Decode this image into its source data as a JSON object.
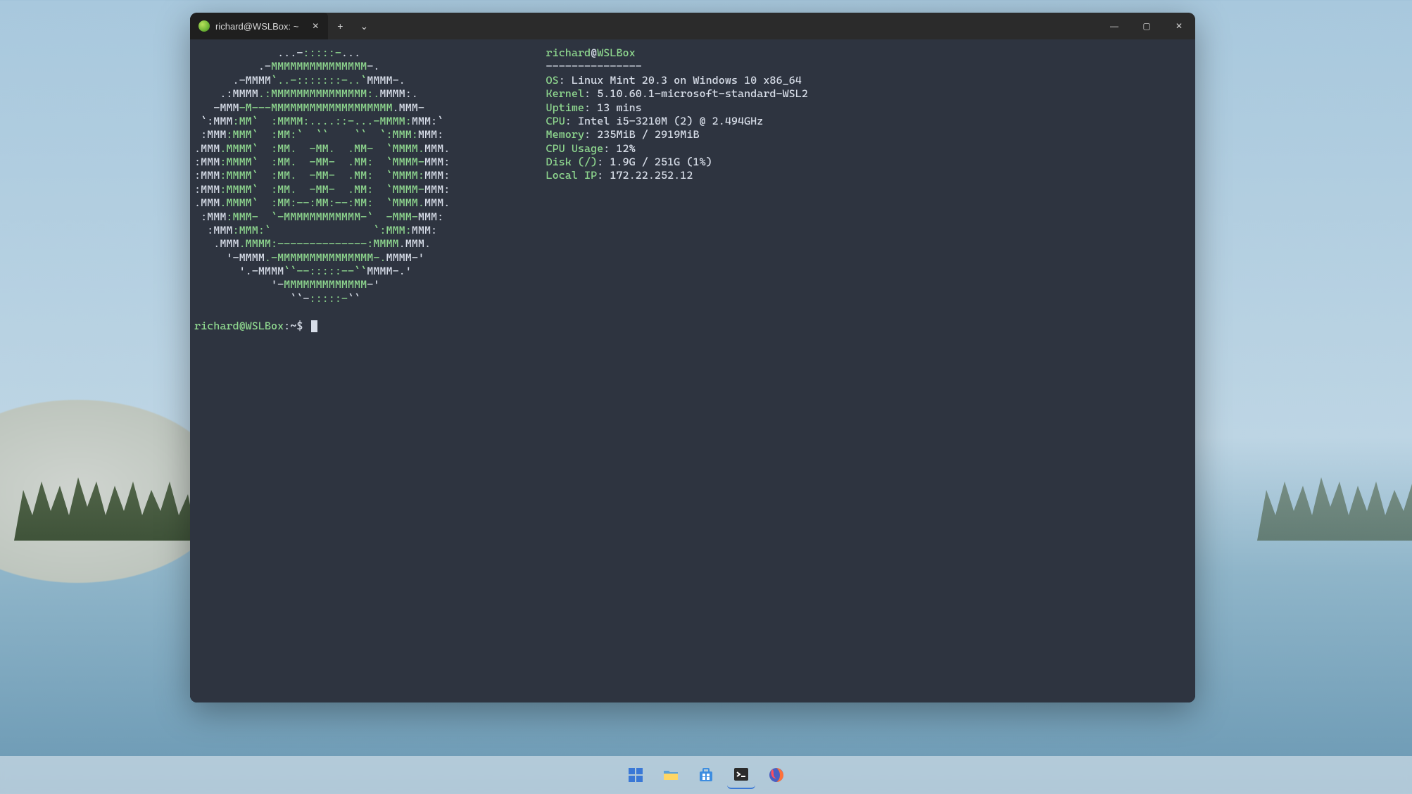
{
  "tab": {
    "title": "richard@WSLBox: ~",
    "icon": "mint-icon"
  },
  "titlebar": {
    "new_tab_tip": "+",
    "dropdown_tip": "⌄"
  },
  "ascii_art": {
    "lines": [
      {
        "pre": "             ",
        "w1": "...-",
        "g": ":::::-",
        "w2": "...             "
      },
      {
        "pre": "          ",
        "w1": ".-",
        "g": "MMMMMMMMMMMMMMM",
        "w2": "-.          "
      },
      {
        "pre": "      ",
        "w1": ".-MMMM",
        "g": "`..-:::::::-..`",
        "w2": "MMMM-.      "
      },
      {
        "pre": "    ",
        "w1": ".:MMMM",
        "g": ".:MMMMMMMMMMMMMMM:.",
        "w2": "MMMM:.    "
      },
      {
        "pre": "   ",
        "w1": "-MMM",
        "g": "-M---MMMMMMMMMMMMMMMMMMM",
        "w2": ".MMM-   "
      },
      {
        "pre": " ",
        "w1": "`:MMM",
        "g": ":MM`  :MMMM:....::-...-MMMM:",
        "w2": "MMM:` "
      },
      {
        "pre": " ",
        "w1": ":MMM",
        "g": ":MMM`  :MM:`  ``    ``  `:MMM:",
        "w2": "MMM: "
      },
      {
        "pre": "",
        "w1": ".MMM",
        "g": ".MMMM`  :MM.  -MM.  .MM-  `MMMM.",
        "w2": "MMM."
      },
      {
        "pre": "",
        "w1": ":MMM",
        "g": ":MMMM`  :MM.  -MM-  .MM:  `MMMM-",
        "w2": "MMM:"
      },
      {
        "pre": "",
        "w1": ":MMM",
        "g": ":MMMM`  :MM.  -MM-  .MM:  `MMMM:",
        "w2": "MMM:"
      },
      {
        "pre": "",
        "w1": ":MMM",
        "g": ":MMMM`  :MM.  -MM-  .MM:  `MMMM-",
        "w2": "MMM:"
      },
      {
        "pre": "",
        "w1": ".MMM",
        "g": ".MMMM`  :MM:--:MM:--:MM:  `MMMM.",
        "w2": "MMM."
      },
      {
        "pre": " ",
        "w1": ":MMM",
        "g": ":MMM-  `-MMMMMMMMMMMM-`  -MMM-",
        "w2": "MMM: "
      },
      {
        "pre": "  ",
        "w1": ":MMM",
        "g": ":MMM:`                `:MMM:",
        "w2": "MMM:  "
      },
      {
        "pre": "   ",
        "w1": ".MMM",
        "g": ".MMMM:--------------:MMMM",
        "w2": ".MMM.   "
      },
      {
        "pre": "     ",
        "w1": "'-MMMM",
        "g": ".-MMMMMMMMMMMMMMM-.",
        "w2": "MMMM-'     "
      },
      {
        "pre": "       ",
        "w1": "'.-MMMM",
        "g": "``--:::::--``",
        "w2": "MMMM-.'       "
      },
      {
        "pre": "            ",
        "w1": "'-",
        "g": "MMMMMMMMMMMMM",
        "w2": "-'            "
      },
      {
        "pre": "               ",
        "w1": "``-",
        "g": ":::::-",
        "w2": "``               "
      }
    ]
  },
  "neofetch": {
    "header_user": "richard",
    "header_at": "@",
    "header_host": "WSLBox",
    "separator": "---------------",
    "rows": [
      {
        "key": "OS",
        "sep": ": ",
        "val": "Linux Mint 20.3 on Windows 10 x86_64"
      },
      {
        "key": "Kernel",
        "sep": ": ",
        "val": "5.10.60.1-microsoft-standard-WSL2"
      },
      {
        "key": "Uptime",
        "sep": ": ",
        "val": "13 mins"
      },
      {
        "key": "CPU",
        "sep": ": ",
        "val": "Intel i5-3210M (2) @ 2.494GHz"
      },
      {
        "key": "Memory",
        "sep": ": ",
        "val": "235MiB / 2919MiB"
      },
      {
        "key": "CPU Usage",
        "sep": ": ",
        "val": "12%"
      },
      {
        "key": "Disk (/)",
        "sep": ": ",
        "val": "1.9G / 251G (1%)"
      },
      {
        "key": "Local IP",
        "sep": ": ",
        "val": "172.22.252.12"
      }
    ]
  },
  "prompt": {
    "user_host": "richard@WSLBox",
    "path": ":~",
    "symbol": "$"
  },
  "taskbar": {
    "items": [
      {
        "name": "start-button",
        "icon": "windows"
      },
      {
        "name": "file-explorer",
        "icon": "explorer"
      },
      {
        "name": "microsoft-store",
        "icon": "store"
      },
      {
        "name": "windows-terminal",
        "icon": "terminal",
        "active": true
      },
      {
        "name": "firefox",
        "icon": "firefox"
      }
    ]
  }
}
